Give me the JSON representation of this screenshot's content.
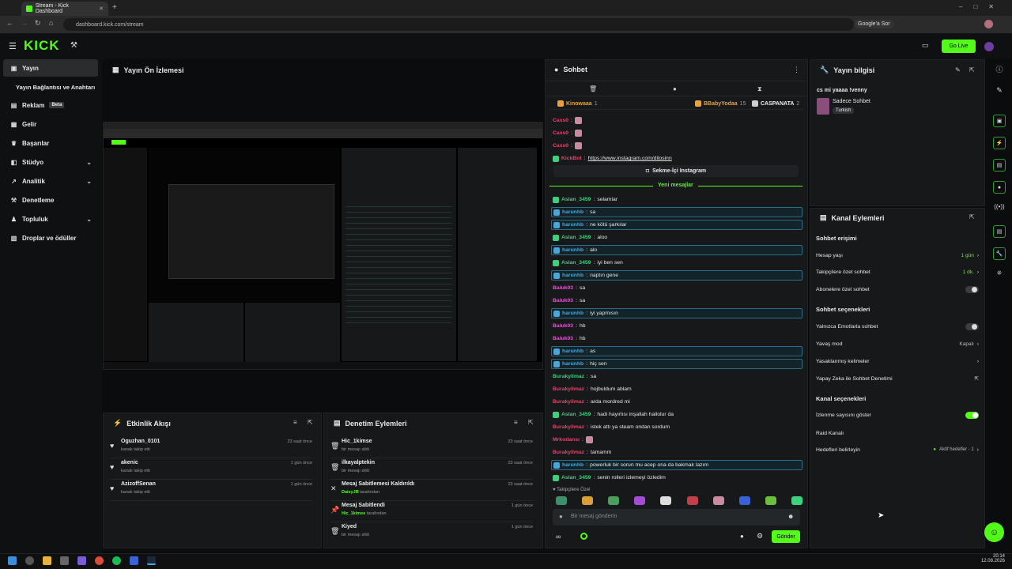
{
  "browser": {
    "tab_title": "Stream - Kick Dashboard",
    "url": "dashboard.kick.com/stream",
    "google_button": "Google'a Sor"
  },
  "header": {
    "logo": "KICK",
    "go_live": "Go Live"
  },
  "sidebar": {
    "items": [
      {
        "label": "Yayın",
        "icon": "broadcast-icon",
        "active": true
      },
      {
        "label": "Yayın Bağlantısı ve Anahtarı",
        "icon": "",
        "sub": true
      },
      {
        "label": "Reklam",
        "icon": "ad-icon",
        "badge": "Beta"
      },
      {
        "label": "Gelir",
        "icon": "revenue-icon"
      },
      {
        "label": "Başarılar",
        "icon": "trophy-icon"
      },
      {
        "label": "Stüdyo",
        "icon": "studio-icon",
        "chevron": true
      },
      {
        "label": "Analitik",
        "icon": "analytics-icon",
        "chevron": true
      },
      {
        "label": "Denetleme",
        "icon": "moderation-icon"
      },
      {
        "label": "Topluluk",
        "icon": "community-icon",
        "chevron": true
      },
      {
        "label": "Droplar ve ödüller",
        "icon": "drops-icon"
      }
    ]
  },
  "preview": {
    "title": "Yayın Ön İzlemesi"
  },
  "activity": {
    "title": "Etkinlik Akışı",
    "items": [
      {
        "name": "Oguzhan_0101",
        "sub": "kanalı takip etti",
        "time": "23 saat önce"
      },
      {
        "name": "akenic",
        "sub": "kanalı takip etti",
        "time": "1 gün önce"
      },
      {
        "name": "AzizoffSenan",
        "sub": "kanalı takip etti",
        "time": "1 gün önce"
      }
    ]
  },
  "modlog": {
    "title": "Denetim Eylemleri",
    "items": [
      {
        "name": "Hic_1kimse",
        "sub": "bir mesajı sildi",
        "by": "",
        "time": "23 saat önce",
        "icon": "trash-icon"
      },
      {
        "name": "ilkayalptekin",
        "sub": "bir mesajı sildi",
        "by": "",
        "time": "23 saat önce",
        "icon": "trash-icon"
      },
      {
        "name": "Mesaj Sabitlemesi Kaldırıldı",
        "sub": "tarafından",
        "by": "DaisyJR",
        "time": "23 saat önce",
        "icon": "unpin-icon"
      },
      {
        "name": "Mesaj Sabitlendi",
        "sub": "tarafından",
        "by": "Hic_1kimse",
        "time": "1 gün önce",
        "icon": "pin-icon"
      },
      {
        "name": "Kiyed",
        "sub": "bir mesajı sildi",
        "by": "",
        "time": "1 gün önce",
        "icon": "trash-icon"
      }
    ]
  },
  "chat": {
    "title": "Sohbet",
    "top_gifters": [
      {
        "name": "Kinowaaa",
        "count": "1"
      },
      {
        "name": "BBabyYodaa",
        "count": "15"
      },
      {
        "name": "CASPANATA",
        "count": "2"
      }
    ],
    "pinned_link_label": "Sekme-İçi Instagram",
    "new_messages": "Yeni mesajlar",
    "messages": [
      {
        "user": "Caxs0",
        "text": "",
        "color": "#e0476b",
        "emote": true
      },
      {
        "user": "Caxs0",
        "text": "",
        "color": "#e0476b",
        "emote": true
      },
      {
        "user": "Caxs0",
        "text": "",
        "color": "#e0476b",
        "emote": true
      },
      {
        "user": "KickBot",
        "text": "https://www.instagram.com/dilosinn",
        "color": "#e0476b",
        "bot": true
      },
      {
        "user": "Aslan_3459",
        "text": "selamlar",
        "color": "#3bd17d"
      },
      {
        "user": "harunhb",
        "text": "sa",
        "color": "#4aa6d6",
        "mention": true
      },
      {
        "user": "harunhb",
        "text": "ne kötü şarkılar",
        "color": "#4aa6d6",
        "mention": true
      },
      {
        "user": "Aslan_3459",
        "text": "aloo",
        "color": "#3bd17d"
      },
      {
        "user": "harunhb",
        "text": "alo",
        "color": "#4aa6d6",
        "mention": true
      },
      {
        "user": "Aslan_3459",
        "text": "iyi ben sen",
        "color": "#3bd17d"
      },
      {
        "user": "harunhb",
        "text": "naptın gene",
        "color": "#4aa6d6",
        "mention": true
      },
      {
        "user": "Baluk03",
        "text": "sa",
        "color": "#d75ec8"
      },
      {
        "user": "Baluk03",
        "text": "sa",
        "color": "#d75ec8"
      },
      {
        "user": "harunhb",
        "text": "iyi yapmısın",
        "color": "#4aa6d6",
        "mention": true
      },
      {
        "user": "Baluk03",
        "text": "hb",
        "color": "#d75ec8"
      },
      {
        "user": "Baluk03",
        "text": "hb",
        "color": "#d75ec8"
      },
      {
        "user": "harunhb",
        "text": "as",
        "color": "#4aa6d6",
        "mention": true
      },
      {
        "user": "harunhb",
        "text": "hiç sen",
        "color": "#4aa6d6",
        "mention": true
      },
      {
        "user": "Burakyilmaz",
        "text": "sa",
        "color": "#3bd17d"
      },
      {
        "user": "Burakyilmaz",
        "text": "hojbuldum ablam",
        "color": "#e0476b"
      },
      {
        "user": "Burakyilmaz",
        "text": "arda mordred mi",
        "color": "#e0476b"
      },
      {
        "user": "Aslan_3459",
        "text": "hadi hayırlısı inşallah hallolur da",
        "color": "#3bd17d"
      },
      {
        "user": "Burakyilmaz",
        "text": "istek attı ya steam ondan sordum",
        "color": "#e0476b"
      },
      {
        "user": "Mrkodansı",
        "text": "",
        "color": "#e0476b",
        "emote": true
      },
      {
        "user": "Burakyilmaz",
        "text": "tamamm",
        "color": "#e0476b"
      },
      {
        "user": "harunhb",
        "text": "powerluk bir sorun mu acep ona da bakmak lazım",
        "color": "#4aa6d6",
        "mention": true
      },
      {
        "user": "Aslan_3459",
        "text": "senin rolleri izlemeyi özledim",
        "color": "#3bd17d"
      }
    ],
    "followers_label": "Takipçilere Özel",
    "input_placeholder": "Bir mesaj gönderin",
    "send_button": "Gönder"
  },
  "stream_info": {
    "title": "Yayın bilgisi",
    "stream_title": "cs mi yaaaa !venny",
    "category": "Sadece Sohbet",
    "language": "Turkish"
  },
  "channel_actions": {
    "title": "Kanal Eylemleri",
    "chat_access": "Sohbet erişimi",
    "account_age": "Hesap yaşı",
    "account_age_value": "1 gün",
    "followers_only": "Takipçilere özel sohbet",
    "followers_only_value": "1 dk.",
    "subs_only": "Abonelere özel sohbet",
    "chat_options": "Sohbet seçenekleri",
    "emote_only": "Yalnızca Emotlarla sohbet",
    "slow_mode": "Yavaş mod",
    "slow_mode_value": "Kapalı",
    "banned_words": "Yasaklanmış kelimeler",
    "ai_moderation": "Yapay Zeka ile Sohbet Denetimi",
    "channel_options": "Kanal seçenekleri",
    "show_viewers": "İzlenme sayısını göster",
    "raid": "Raid Kanalı",
    "goals": "Hedefleri belirleyin",
    "goals_value": "Aktif hedefler - 1"
  },
  "taskbar": {
    "time": "20:14",
    "date": "12.08.2026"
  }
}
